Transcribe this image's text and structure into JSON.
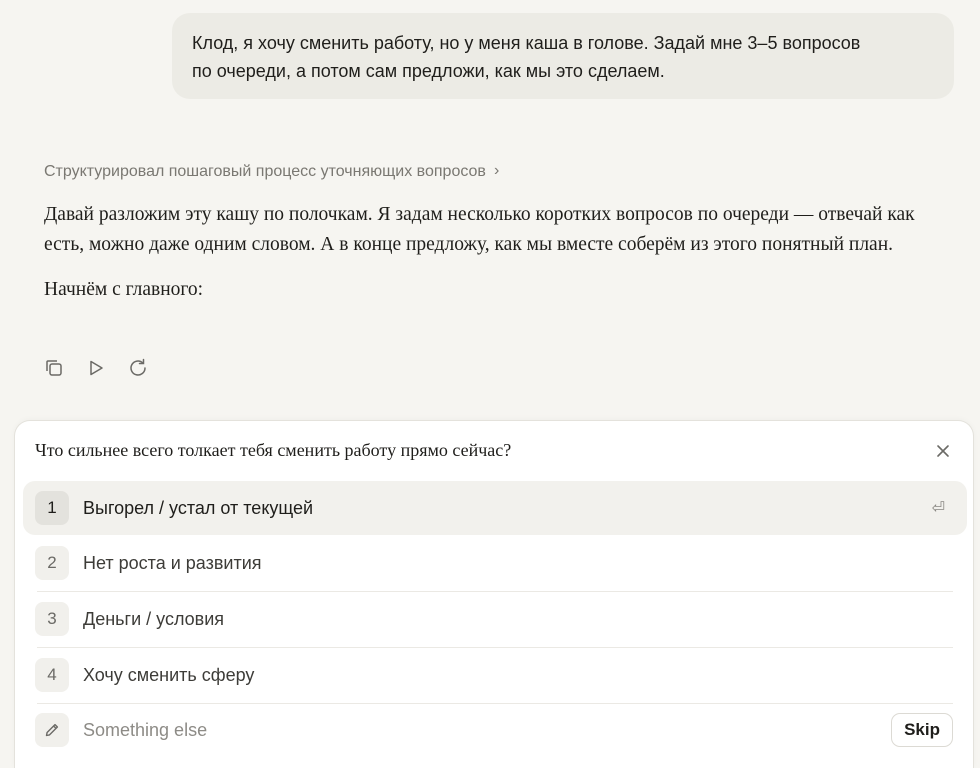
{
  "user_message": {
    "line1": "Клод, я хочу сменить работу, но у меня каша в голове. Задай мне 3–5 вопросов",
    "line2": "по очереди, а потом сам предложи, как мы это сделаем."
  },
  "thinking": {
    "label": "Структурировал пошаговый процесс уточняющих вопросов",
    "chevron": "›"
  },
  "assistant": {
    "paragraph1": "Давай разложим эту кашу по полочкам. Я задам несколько коротких вопросов по очереди — отвечай как есть, можно даже одним словом. А в конце предложу, как мы вместе соберём из этого понятный план.",
    "paragraph2": "Начнём с главного:"
  },
  "actions": {
    "icons": [
      "copy-icon",
      "play-icon",
      "retry-icon"
    ]
  },
  "question_panel": {
    "question": "Что сильнее всего толкает тебя сменить работу прямо сейчас?",
    "options": [
      {
        "num": "1",
        "label": "Выгорел / устал от текущей",
        "selected": true
      },
      {
        "num": "2",
        "label": "Нет роста и развития",
        "selected": false
      },
      {
        "num": "3",
        "label": "Деньги / условия",
        "selected": false
      },
      {
        "num": "4",
        "label": "Хочу сменить сферу",
        "selected": false
      }
    ],
    "enter_glyph": "⏎",
    "other_placeholder": "Something else",
    "skip_label": "Skip"
  },
  "colors": {
    "background": "#f6f5f1",
    "user_bubble": "#ecebe5",
    "panel": "#ffffff",
    "selected_row": "#f2f1ed"
  }
}
